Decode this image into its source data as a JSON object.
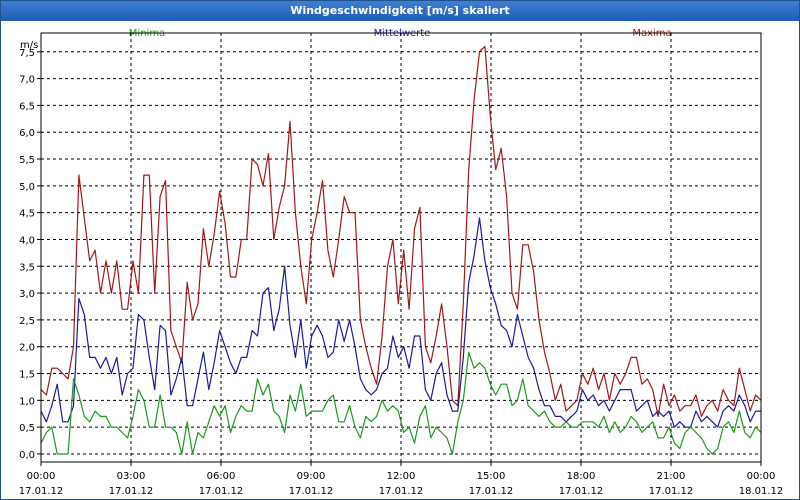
{
  "window": {
    "title": "Windgeschwindigkeit [m/s] skaliert"
  },
  "chart_data": {
    "type": "line",
    "title": "Windgeschwindigkeit [m/s] skaliert",
    "ylabel": "m/s",
    "ylim": [
      -0.15,
      7.85
    ],
    "yticks": [
      "0,0",
      "0,5",
      "1,0",
      "1,5",
      "2,0",
      "2,5",
      "3,0",
      "3,5",
      "4,0",
      "4,5",
      "5,0",
      "5,5",
      "6,0",
      "6,5",
      "7,0",
      "7,5"
    ],
    "xlim": [
      0,
      24
    ],
    "xticks": [
      {
        "time": "00:00",
        "date": "17.01.12"
      },
      {
        "time": "03:00",
        "date": "17.01.12"
      },
      {
        "time": "06:00",
        "date": "17.01.12"
      },
      {
        "time": "09:00",
        "date": "17.01.12"
      },
      {
        "time": "12:00",
        "date": "17.01.12"
      },
      {
        "time": "15:00",
        "date": "17.01.12"
      },
      {
        "time": "18:00",
        "date": "17.01.12"
      },
      {
        "time": "21:00",
        "date": "17.01.12"
      },
      {
        "time": "00:00",
        "date": "18.01.12"
      }
    ],
    "grid": true,
    "legend_position": "top",
    "series": [
      {
        "name": "Maxima",
        "color": "#a01818",
        "values": [
          1.2,
          1.1,
          1.6,
          1.6,
          1.5,
          1.4,
          2.0,
          5.2,
          4.4,
          3.6,
          3.8,
          3.0,
          3.6,
          3.0,
          3.6,
          2.7,
          2.7,
          3.6,
          3.0,
          5.2,
          5.2,
          3.0,
          4.8,
          5.1,
          2.3,
          2.0,
          1.7,
          3.2,
          2.5,
          2.8,
          4.2,
          3.5,
          4.1,
          4.9,
          4.3,
          3.3,
          3.3,
          4.0,
          4.0,
          5.5,
          5.4,
          5.0,
          5.6,
          4.0,
          4.6,
          5.0,
          6.2,
          4.5,
          3.5,
          2.8,
          4.0,
          4.5,
          5.1,
          3.8,
          3.3,
          4.0,
          4.8,
          4.5,
          4.5,
          2.5,
          2.0,
          1.6,
          1.3,
          2.2,
          3.5,
          4.0,
          2.8,
          3.8,
          2.7,
          4.2,
          4.6,
          2.0,
          1.7,
          2.2,
          2.8,
          2.0,
          1.0,
          0.9,
          2.8,
          5.3,
          6.6,
          7.5,
          7.6,
          6.3,
          5.3,
          5.7,
          4.8,
          3.0,
          2.7,
          3.9,
          3.9,
          3.4,
          2.5,
          1.9,
          1.5,
          1.0,
          1.3,
          0.8,
          0.9,
          1.0,
          1.5,
          1.3,
          1.6,
          1.2,
          1.5,
          1.0,
          1.5,
          1.3,
          1.5,
          1.8,
          1.8,
          1.3,
          1.4,
          1.2,
          0.7,
          1.3,
          0.9,
          1.1,
          0.8,
          0.9,
          0.9,
          1.1,
          0.7,
          0.9,
          1.0,
          0.8,
          1.2,
          1.0,
          0.9,
          1.6,
          1.2,
          0.8,
          1.1,
          1.0
        ]
      },
      {
        "name": "Mittelwerte",
        "color": "#1a1aa0",
        "values": [
          0.8,
          0.6,
          0.9,
          1.3,
          0.6,
          0.6,
          0.9,
          2.9,
          2.6,
          1.8,
          1.8,
          1.6,
          1.8,
          1.5,
          1.8,
          1.1,
          1.5,
          1.6,
          2.6,
          2.5,
          1.8,
          1.2,
          2.4,
          2.3,
          1.1,
          1.4,
          1.8,
          0.9,
          0.9,
          1.4,
          1.9,
          1.2,
          1.7,
          2.3,
          2.0,
          1.7,
          1.5,
          1.8,
          1.8,
          2.3,
          2.2,
          3.0,
          3.1,
          2.3,
          2.7,
          3.5,
          2.4,
          1.8,
          2.5,
          1.6,
          2.2,
          2.4,
          2.2,
          1.8,
          1.9,
          2.5,
          2.1,
          2.5,
          2.0,
          1.4,
          1.2,
          1.1,
          1.2,
          1.5,
          1.6,
          2.2,
          1.8,
          2.0,
          1.6,
          2.2,
          2.2,
          1.2,
          1.0,
          1.5,
          1.7,
          1.1,
          0.8,
          0.8,
          1.8,
          3.2,
          3.7,
          4.4,
          3.6,
          3.1,
          2.8,
          2.4,
          2.3,
          2.0,
          2.6,
          2.2,
          1.8,
          1.6,
          1.2,
          0.9,
          0.9,
          0.7,
          0.7,
          0.6,
          0.7,
          0.8,
          1.2,
          1.0,
          1.1,
          0.9,
          1.0,
          0.8,
          1.0,
          1.2,
          1.2,
          1.2,
          0.8,
          0.9,
          1.0,
          0.7,
          0.8,
          0.7,
          0.8,
          0.5,
          0.6,
          0.5,
          0.5,
          0.8,
          0.6,
          0.7,
          0.6,
          0.5,
          0.8,
          0.9,
          0.8,
          1.1,
          0.9,
          0.6,
          0.8,
          0.8
        ]
      },
      {
        "name": "Minima",
        "color": "#1a9a1a",
        "values": [
          0.2,
          0.4,
          0.5,
          0.0,
          0.0,
          0.0,
          1.4,
          1.1,
          0.7,
          0.6,
          0.8,
          0.7,
          0.7,
          0.5,
          0.5,
          0.4,
          0.3,
          0.7,
          1.2,
          1.0,
          0.5,
          0.5,
          1.1,
          0.5,
          0.5,
          0.4,
          0.0,
          0.6,
          0.0,
          0.4,
          0.3,
          0.6,
          0.9,
          0.7,
          0.9,
          0.4,
          0.7,
          0.9,
          0.8,
          0.8,
          1.4,
          1.1,
          1.3,
          0.8,
          0.7,
          0.4,
          1.1,
          0.8,
          1.3,
          0.7,
          0.8,
          0.8,
          0.8,
          1.0,
          1.1,
          0.6,
          0.6,
          0.9,
          0.5,
          0.3,
          0.7,
          0.6,
          0.7,
          1.0,
          0.8,
          0.9,
          0.8,
          0.4,
          0.5,
          0.2,
          0.7,
          0.9,
          0.3,
          0.5,
          0.4,
          0.3,
          0.0,
          0.6,
          1.0,
          1.9,
          1.6,
          1.7,
          1.6,
          1.3,
          1.1,
          1.3,
          1.3,
          0.9,
          1.0,
          1.4,
          0.9,
          0.8,
          0.7,
          0.8,
          0.6,
          0.5,
          0.5,
          0.6,
          0.5,
          0.5,
          0.6,
          0.6,
          0.6,
          0.5,
          0.7,
          0.4,
          0.6,
          0.4,
          0.5,
          0.7,
          0.6,
          0.4,
          0.5,
          0.6,
          0.3,
          0.3,
          0.5,
          0.2,
          0.1,
          0.4,
          0.5,
          0.4,
          0.3,
          0.1,
          0.0,
          0.1,
          0.5,
          0.6,
          0.4,
          0.8,
          0.4,
          0.3,
          0.5,
          0.4
        ]
      }
    ]
  }
}
